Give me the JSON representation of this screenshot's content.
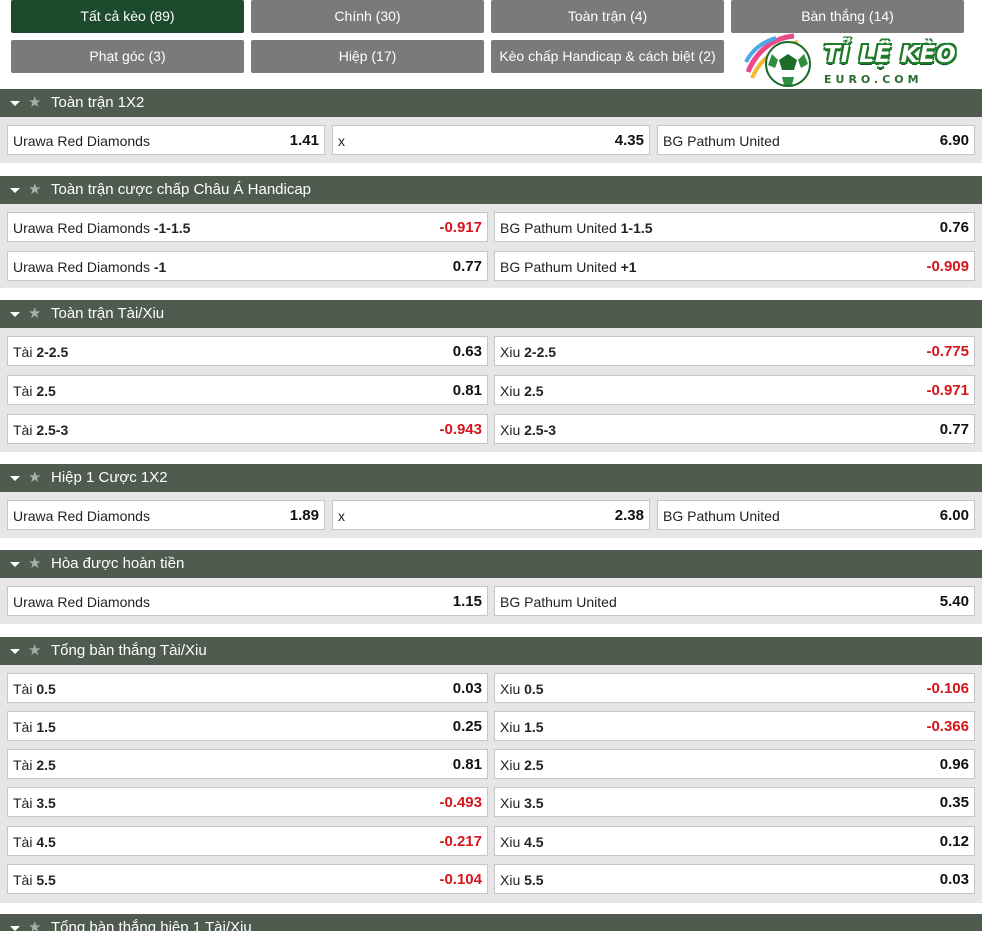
{
  "tabs": [
    {
      "label": "Tất cả kèo (89)",
      "active": true
    },
    {
      "label": "Chính (30)"
    },
    {
      "label": "Toàn trận (4)"
    },
    {
      "label": "Bàn thắng (14)"
    },
    {
      "label": "Phạt góc (3)"
    },
    {
      "label": "Hiệp (17)"
    },
    {
      "label": "Kèo chấp Handicap & cách biệt (2)"
    }
  ],
  "logo": {
    "main": "TỈ LỆ KÈO",
    "sub": "EURO.COM"
  },
  "sections": [
    {
      "title": "Toàn trận 1X2",
      "rows": [
        [
          {
            "name": "Urawa Red Diamonds",
            "odd": "1.41"
          },
          {
            "name": "x",
            "odd": "4.35"
          },
          {
            "name": "BG Pathum United",
            "odd": "6.90"
          }
        ]
      ]
    },
    {
      "title": "Toàn trận cược chấp Châu Á Handicap",
      "rows": [
        [
          {
            "name": "Urawa Red Diamonds",
            "line": "-1-1.5",
            "odd": "-0.917"
          },
          {
            "name": "BG Pathum United",
            "line": "1-1.5",
            "odd": "0.76"
          }
        ],
        [
          {
            "name": "Urawa Red Diamonds",
            "line": "-1",
            "odd": "0.77"
          },
          {
            "name": "BG Pathum United",
            "line": "+1",
            "odd": "-0.909"
          }
        ]
      ]
    },
    {
      "title": "Toàn trận Tài/Xiu",
      "rows": [
        [
          {
            "name": "Tài",
            "line": "2-2.5",
            "odd": "0.63"
          },
          {
            "name": "Xiu",
            "line": "2-2.5",
            "odd": "-0.775"
          }
        ],
        [
          {
            "name": "Tài",
            "line": "2.5",
            "odd": "0.81"
          },
          {
            "name": "Xiu",
            "line": "2.5",
            "odd": "-0.971"
          }
        ],
        [
          {
            "name": "Tài",
            "line": "2.5-3",
            "odd": "-0.943"
          },
          {
            "name": "Xiu",
            "line": "2.5-3",
            "odd": "0.77"
          }
        ]
      ]
    },
    {
      "title": "Hiệp 1 Cược 1X2",
      "rows": [
        [
          {
            "name": "Urawa Red Diamonds",
            "odd": "1.89"
          },
          {
            "name": "x",
            "odd": "2.38"
          },
          {
            "name": "BG Pathum United",
            "odd": "6.00"
          }
        ]
      ]
    },
    {
      "title": "Hòa được hoàn tiền",
      "rows": [
        [
          {
            "name": "Urawa Red Diamonds",
            "odd": "1.15"
          },
          {
            "name": "BG Pathum United",
            "odd": "5.40"
          }
        ]
      ]
    },
    {
      "title": "Tổng bàn thắng Tài/Xiu",
      "rows": [
        [
          {
            "name": "Tài",
            "line": "0.5",
            "odd": "0.03"
          },
          {
            "name": "Xiu",
            "line": "0.5",
            "odd": "-0.106"
          }
        ],
        [
          {
            "name": "Tài",
            "line": "1.5",
            "odd": "0.25"
          },
          {
            "name": "Xiu",
            "line": "1.5",
            "odd": "-0.366"
          }
        ],
        [
          {
            "name": "Tài",
            "line": "2.5",
            "odd": "0.81"
          },
          {
            "name": "Xiu",
            "line": "2.5",
            "odd": "0.96"
          }
        ],
        [
          {
            "name": "Tài",
            "line": "3.5",
            "odd": "-0.493"
          },
          {
            "name": "Xiu",
            "line": "3.5",
            "odd": "0.35"
          }
        ],
        [
          {
            "name": "Tài",
            "line": "4.5",
            "odd": "-0.217"
          },
          {
            "name": "Xiu",
            "line": "4.5",
            "odd": "0.12"
          }
        ],
        [
          {
            "name": "Tài",
            "line": "5.5",
            "odd": "-0.104"
          },
          {
            "name": "Xiu",
            "line": "5.5",
            "odd": "0.03"
          }
        ]
      ]
    },
    {
      "title": "Tổng bàn thắng hiệp 1 Tài/Xiu",
      "rows": []
    }
  ],
  "colors": {
    "positive": "#111111",
    "negative": "#d4151b",
    "header": "#4f5b4f",
    "tab_active": "#1d4a2c",
    "tab": "#7a7a7a"
  }
}
